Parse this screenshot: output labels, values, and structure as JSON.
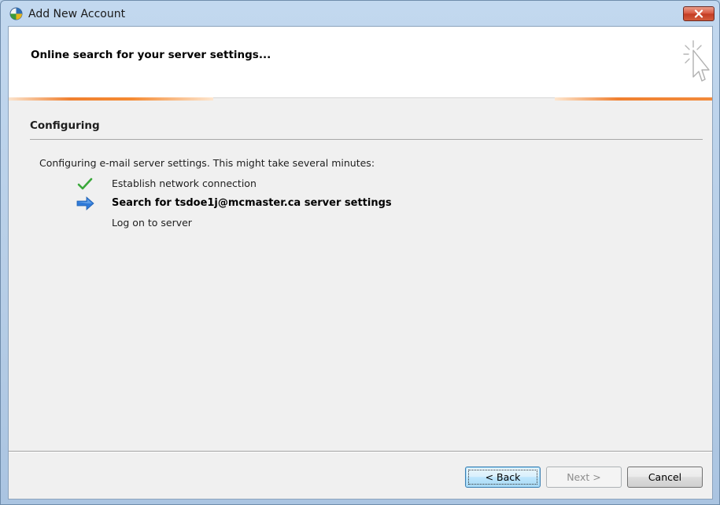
{
  "window": {
    "title": "Add New Account"
  },
  "header": {
    "title": "Online search for your server settings..."
  },
  "section": {
    "title": "Configuring",
    "description": "Configuring e-mail server settings. This might take several minutes:"
  },
  "steps": [
    {
      "label": "Establish network connection",
      "status": "done",
      "icon": "check-icon"
    },
    {
      "label": "Search for tsdoe1j@mcmaster.ca server settings",
      "status": "active",
      "icon": "arrow-right-icon"
    },
    {
      "label": "Log on to server",
      "status": "pending",
      "icon": ""
    }
  ],
  "buttons": {
    "back": "< Back",
    "next": "Next >",
    "cancel": "Cancel"
  },
  "colors": {
    "accent_orange": "#f08030",
    "check_green": "#3aa83a",
    "arrow_blue": "#2f7ad8",
    "close_red": "#c8432a"
  }
}
